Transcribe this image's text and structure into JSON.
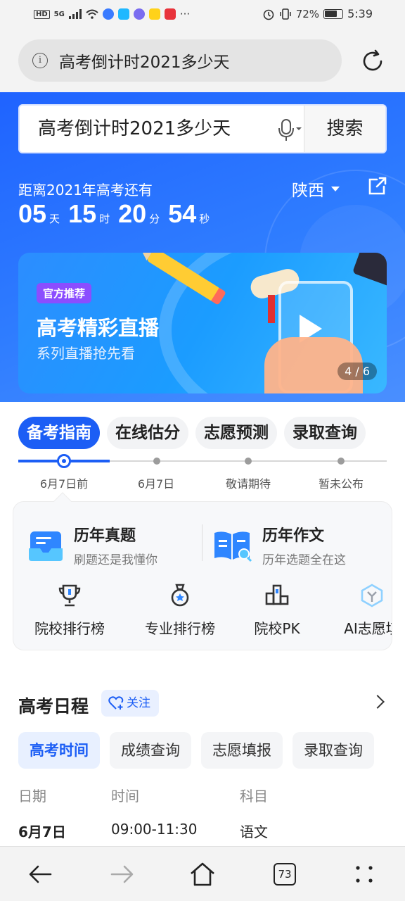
{
  "status_bar": {
    "network": "5G",
    "battery": "72%",
    "time": "5:39",
    "hd": "HD",
    "more": "···"
  },
  "browser": {
    "url_text": "高考倒计时2021多少天",
    "tab_count": "73"
  },
  "search": {
    "query": "高考倒计时2021多少天",
    "button_label": "搜索"
  },
  "countdown": {
    "label": "距离2021年高考还有",
    "region": "陕西",
    "days": "05",
    "days_unit": "天",
    "hours": "15",
    "hours_unit": "时",
    "minutes": "20",
    "minutes_unit": "分",
    "seconds": "54",
    "seconds_unit": "秒"
  },
  "banner": {
    "tag": "官方推荐",
    "title": "高考精彩直播",
    "subtitle": "系列直播抢先看",
    "pager": "4 / 6"
  },
  "guide_tabs": [
    {
      "label": "备考指南",
      "date": "6月7日前"
    },
    {
      "label": "在线估分",
      "date": "6月7日"
    },
    {
      "label": "志愿预测",
      "date": "敬请期待"
    },
    {
      "label": "录取查询",
      "date": "暂未公布"
    }
  ],
  "features": [
    {
      "title": "历年真题",
      "subtitle": "刷题还是我懂你",
      "icon": "exam-tray-icon"
    },
    {
      "title": "历年作文",
      "subtitle": "历年选题全在这",
      "icon": "essay-book-icon"
    }
  ],
  "tools": [
    {
      "label": "院校排行榜",
      "icon": "trophy-icon"
    },
    {
      "label": "专业排行榜",
      "icon": "medal-icon"
    },
    {
      "label": "院校PK",
      "icon": "podium-icon"
    },
    {
      "label": "AI志愿填",
      "icon": "ai-cube-icon"
    }
  ],
  "schedule": {
    "title": "高考日程",
    "follow_label": "关注",
    "tabs": [
      "高考时间",
      "成绩查询",
      "志愿填报",
      "录取查询"
    ],
    "headers": [
      "日期",
      "时间",
      "科目"
    ],
    "rows": [
      [
        "6月7日",
        "09:00-11:30",
        "语文"
      ]
    ]
  },
  "colors": {
    "accent": "#1c5ef5",
    "hero_bg": "#2f7dff",
    "tag_purple": "#8b4dff"
  }
}
